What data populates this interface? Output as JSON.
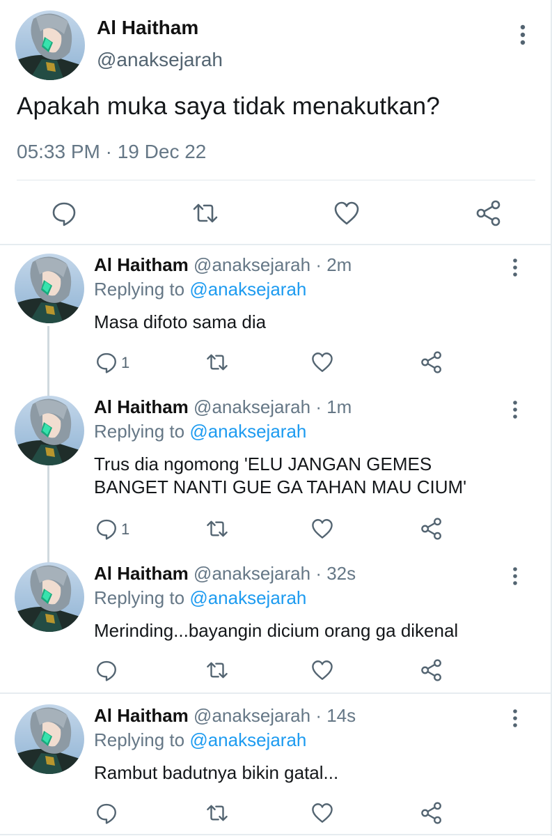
{
  "main_tweet": {
    "author_name": "Al Haitham",
    "author_handle": "@anaksejarah",
    "text": "Apakah muka saya tidak menakutkan?",
    "timestamp": "05:33 PM · 19 Dec 22"
  },
  "replies": [
    {
      "name": "Al Haitham",
      "handle": "@anaksejarah",
      "age": "· 2m",
      "replying_prefix": "Replying to ",
      "replying_to": "@anaksejarah",
      "text": "Masa difoto sama dia",
      "reply_count": "1"
    },
    {
      "name": "Al Haitham",
      "handle": "@anaksejarah",
      "age": "· 1m",
      "replying_prefix": "Replying to ",
      "replying_to": "@anaksejarah",
      "text_line1": "Trus dia ngomong 'ELU JANGAN GEMES",
      "text_line2": "BANGET NANTI GUE GA TAHAN MAU CIUM'",
      "reply_count": "1"
    },
    {
      "name": "Al Haitham",
      "handle": "@anaksejarah",
      "age": "· 32s",
      "replying_prefix": "Replying to ",
      "replying_to": "@anaksejarah",
      "text": "Merinding...bayangin dicium orang ga dikenal"
    },
    {
      "name": "Al Haitham",
      "handle": "@anaksejarah",
      "age": "· 14s",
      "replying_prefix": "Replying to ",
      "replying_to": "@anaksejarah",
      "text": "Rambut badutnya bikin gatal..."
    }
  ],
  "icons": {
    "reply": "comment-icon",
    "retweet": "retweet-icon",
    "like": "heart-icon",
    "share": "share-icon",
    "more": "more-vertical-icon"
  },
  "colors": {
    "link": "#1d9bf0",
    "secondary_text": "#657786",
    "icon": "#536471"
  }
}
